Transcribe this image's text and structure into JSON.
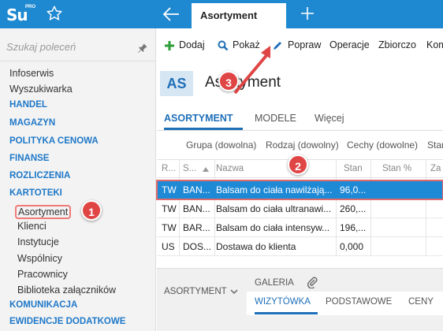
{
  "app": {
    "logo_text": "Su",
    "logo_sup": "PRO",
    "active_tab": "Asortyment",
    "brand_color": "#1e88d0"
  },
  "sidebar": {
    "search_placeholder": "Szukaj poleceń",
    "items": [
      {
        "label": "Infoserwis",
        "type": "item"
      },
      {
        "label": "Wyszukiwarka",
        "type": "item"
      },
      {
        "label": "HANDEL",
        "type": "section"
      },
      {
        "label": "MAGAZYN",
        "type": "section"
      },
      {
        "label": "POLITYKA CENOWA",
        "type": "section"
      },
      {
        "label": "FINANSE",
        "type": "section"
      },
      {
        "label": "ROZLICZENIA",
        "type": "section"
      },
      {
        "label": "KARTOTEKI",
        "type": "section"
      },
      {
        "label": "Asortyment",
        "type": "sub",
        "selected": true
      },
      {
        "label": "Klienci",
        "type": "sub"
      },
      {
        "label": "Instytucje",
        "type": "sub"
      },
      {
        "label": "Wspólnicy",
        "type": "sub"
      },
      {
        "label": "Pracownicy",
        "type": "sub"
      },
      {
        "label": "Biblioteka załączników",
        "type": "sub"
      },
      {
        "label": "KOMUNIKACJA",
        "type": "section"
      },
      {
        "label": "EWIDENCJE DODATKOWE",
        "type": "section"
      }
    ]
  },
  "toolbar": {
    "add": "Dodaj",
    "show": "Pokaż",
    "edit": "Popraw",
    "operations": "Operacje",
    "bulk": "Zbiorczo",
    "more": "Kom"
  },
  "header": {
    "badge": "AS",
    "title": "Asortyment"
  },
  "tabs": {
    "assortment": "ASORTYMENT",
    "models": "MODELE",
    "more": "Więcej"
  },
  "filters": {
    "group": "Grupa (dowolna)",
    "kind": "Rodzaj (dowolny)",
    "features": "Cechy (dowolne)",
    "state": "Stan (do"
  },
  "table": {
    "headers": [
      "R...",
      "S...",
      "Nazwa",
      "Stan",
      "Stan %",
      "Za"
    ],
    "rows": [
      {
        "r": "TW",
        "s": "BAN...",
        "name": "Balsam do ciała nawilżają...",
        "stan": "96,0...",
        "selected": true
      },
      {
        "r": "TW",
        "s": "BAN...",
        "name": "Balsam do ciała ultranawi...",
        "stan": "260,..."
      },
      {
        "r": "TW",
        "s": "BAR...",
        "name": "Balsam do ciała intensyw...",
        "stan": "196,..."
      },
      {
        "r": "US",
        "s": "DOS...",
        "name": "Dostawa do klienta",
        "stan": "0,000"
      }
    ]
  },
  "bottom": {
    "assortment": "ASORTYMENT",
    "gallery": "GALERIA",
    "card": "WIZYTÓWKA",
    "basic": "PODSTAWOWE",
    "prices": "CENY"
  },
  "annotations": {
    "one": "1",
    "two": "2",
    "three": "3",
    "color": "#e04545"
  }
}
